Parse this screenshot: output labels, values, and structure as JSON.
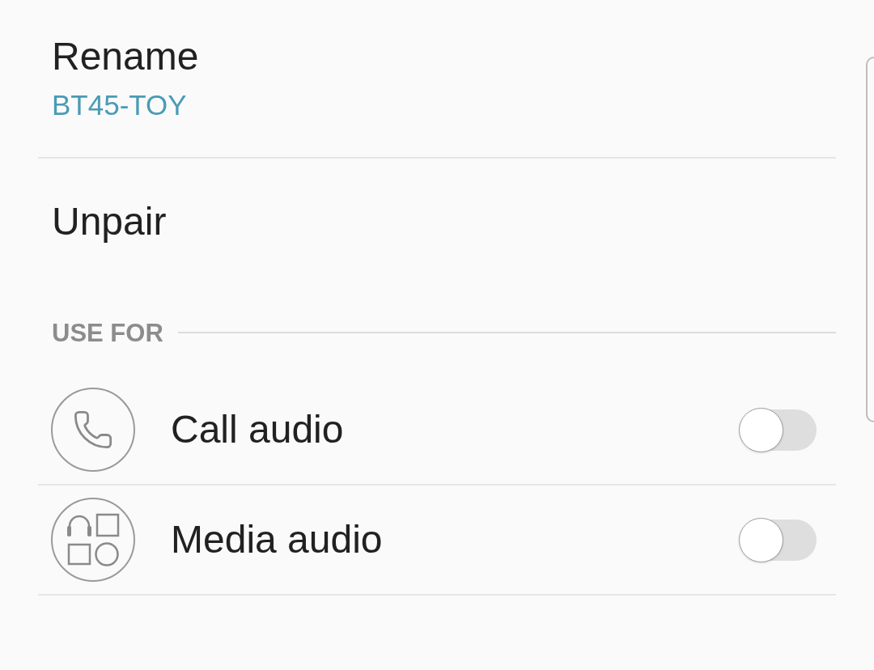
{
  "items": [
    {
      "title": "Rename",
      "subtitle": "BT45-TOY"
    },
    {
      "title": "Unpair"
    }
  ],
  "section": {
    "header": "USE FOR",
    "profiles": [
      {
        "kind": "call",
        "label": "Call audio",
        "on": false
      },
      {
        "kind": "media",
        "label": "Media audio",
        "on": false
      }
    ]
  }
}
